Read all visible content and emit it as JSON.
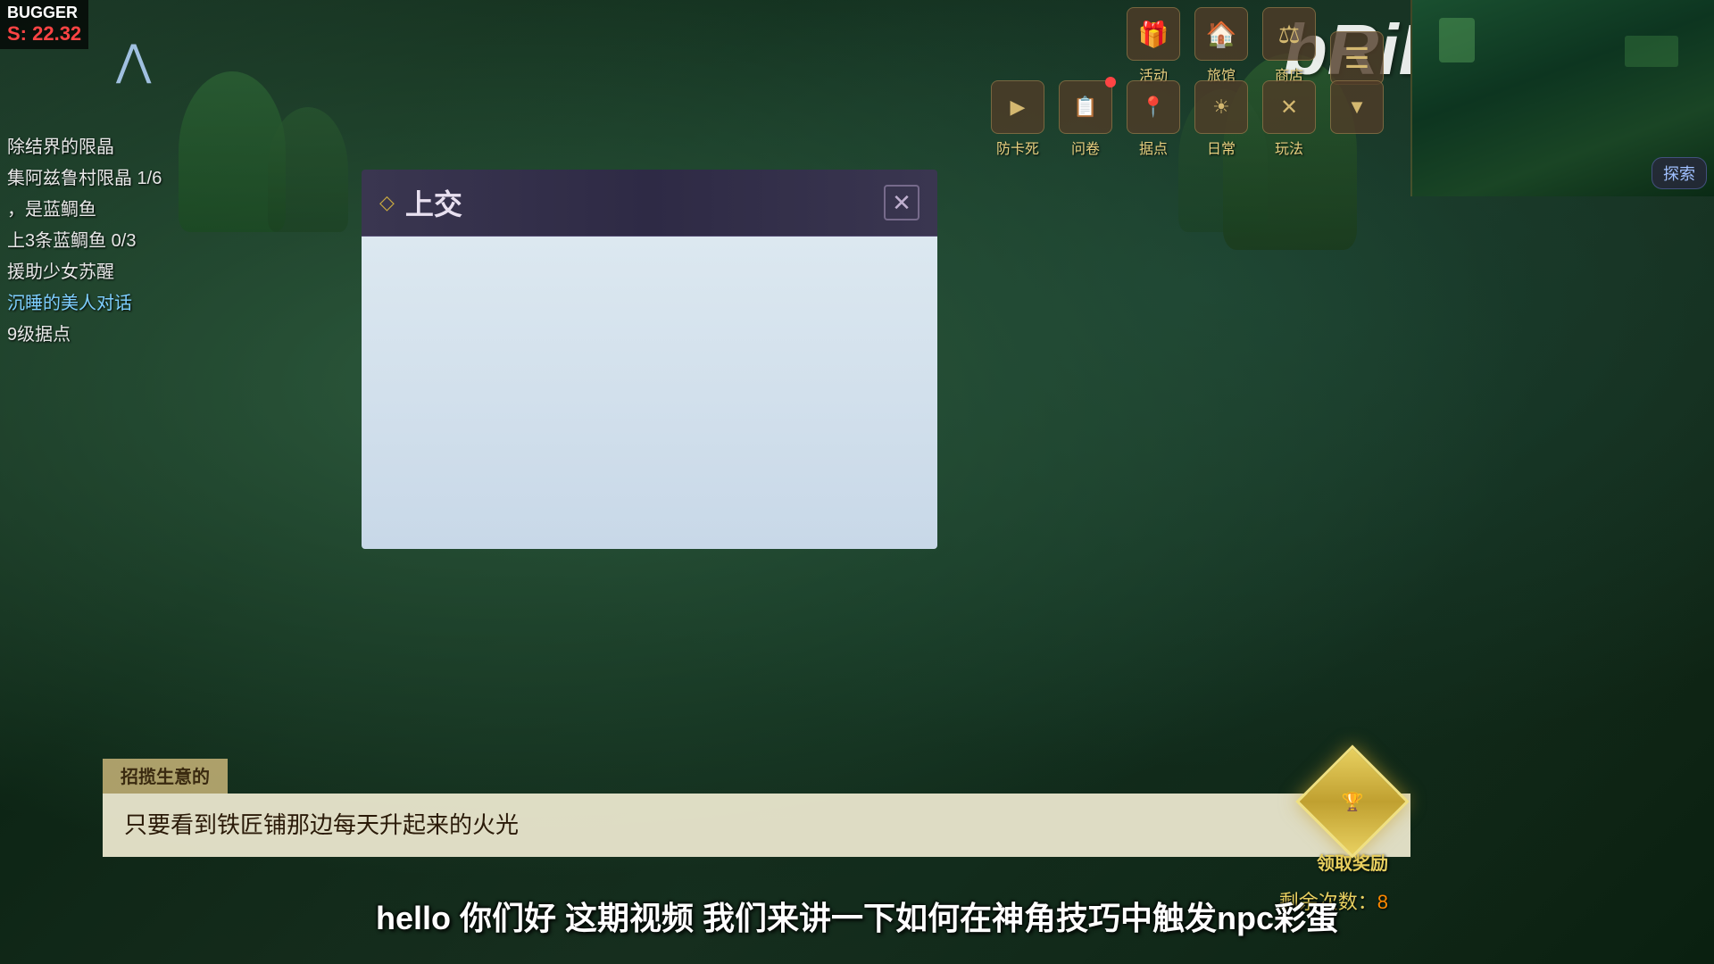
{
  "game": {
    "title": "BUGGER",
    "fps_label": "S: 22.32",
    "watermark": "bRiE"
  },
  "debug": {
    "title": "BUGGER",
    "fps": "S: 22.32"
  },
  "quests": {
    "items": [
      {
        "text": "除结界的限晶",
        "active": false
      },
      {
        "text": "集阿兹鲁村限晶 1/6",
        "active": false
      },
      {
        "text": "，是蓝鲷鱼",
        "active": false
      },
      {
        "text": "上3条蓝鲷鱼 0/3",
        "active": false
      },
      {
        "text": "援助少女苏醒",
        "active": false
      },
      {
        "text": "沉睡的美人对话",
        "active": true
      },
      {
        "text": "9级据点",
        "active": false
      }
    ]
  },
  "top_nav_row1": {
    "items": [
      {
        "icon": "🎁",
        "label": "活动"
      },
      {
        "icon": "🏠",
        "label": "旅馆"
      },
      {
        "icon": "⚖",
        "label": "商店"
      },
      {
        "icon": "☰",
        "label": ""
      }
    ]
  },
  "top_nav_row2": {
    "items": [
      {
        "icon": "▶",
        "label": "防卡死",
        "has_notification": false
      },
      {
        "icon": "📋",
        "label": "问卷",
        "has_notification": true
      },
      {
        "icon": "📍",
        "label": "据点",
        "has_notification": false
      },
      {
        "icon": "☀",
        "label": "日常",
        "has_notification": false
      },
      {
        "icon": "✕",
        "label": "玩法",
        "has_notification": false
      },
      {
        "icon": "▼",
        "label": "",
        "has_notification": false
      }
    ]
  },
  "modal": {
    "title": "上交",
    "diamond_icon": "◇",
    "close_icon": "✕",
    "body_empty": true
  },
  "dialogue": {
    "speaker_label": "招揽生意的",
    "text": "只要看到铁匠铺那边每天升起来的火光"
  },
  "subtitle": {
    "text": "hello 你们好 这期视频 我们来讲一下如何在神角技巧中触发npc彩蛋"
  },
  "reward": {
    "label": "领取奖励",
    "remaining_text": "剩余次数：",
    "remaining_count": "8"
  },
  "minimap": {
    "explore_label": "探索"
  }
}
